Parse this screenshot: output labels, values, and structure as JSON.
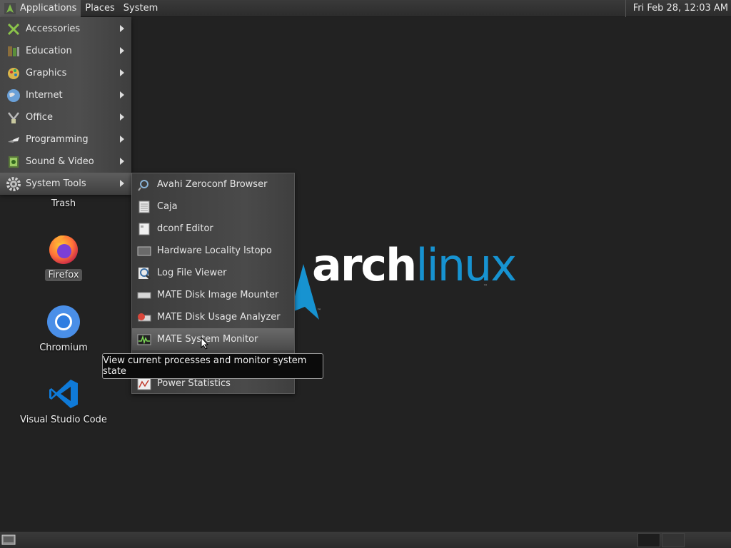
{
  "top_panel": {
    "applications_label": "Applications",
    "places_label": "Places",
    "system_label": "System",
    "clock": "Fri Feb 28, 12:03 AM"
  },
  "applications_menu": {
    "items": [
      {
        "label": "Accessories",
        "icon": "accessories-icon"
      },
      {
        "label": "Education",
        "icon": "education-icon"
      },
      {
        "label": "Graphics",
        "icon": "graphics-icon"
      },
      {
        "label": "Internet",
        "icon": "internet-icon"
      },
      {
        "label": "Office",
        "icon": "office-icon"
      },
      {
        "label": "Programming",
        "icon": "programming-icon"
      },
      {
        "label": "Sound & Video",
        "icon": "sound-video-icon"
      },
      {
        "label": "System Tools",
        "icon": "system-tools-icon"
      }
    ],
    "active": "System Tools"
  },
  "system_tools_menu": {
    "items": [
      {
        "label": "Avahi Zeroconf Browser",
        "icon": "avahi-icon"
      },
      {
        "label": "Caja",
        "icon": "caja-icon"
      },
      {
        "label": "dconf Editor",
        "icon": "dconf-icon"
      },
      {
        "label": "Hardware Locality lstopo",
        "icon": "lstopo-icon"
      },
      {
        "label": "Log File Viewer",
        "icon": "log-viewer-icon"
      },
      {
        "label": "MATE Disk Image Mounter",
        "icon": "disk-mounter-icon"
      },
      {
        "label": "MATE Disk Usage Analyzer",
        "icon": "disk-usage-icon"
      },
      {
        "label": "MATE System Monitor",
        "icon": "system-monitor-icon"
      },
      {
        "label": "Power Statistics",
        "icon": "power-stats-icon"
      }
    ],
    "hovered": "MATE System Monitor"
  },
  "tooltip": "View current processes and monitor system state",
  "desktop": {
    "icons": [
      {
        "label": "Trash",
        "icon": "trash-icon"
      },
      {
        "label": "Firefox",
        "icon": "firefox-icon"
      },
      {
        "label": "Chromium",
        "icon": "chromium-icon"
      },
      {
        "label": "Visual Studio Code",
        "icon": "vscode-icon"
      }
    ],
    "wallpaper": {
      "text_bold": "arch",
      "text_light": "linux",
      "mark": "™"
    }
  },
  "colors": {
    "arch_blue": "#1793d1",
    "background": "#222222"
  }
}
